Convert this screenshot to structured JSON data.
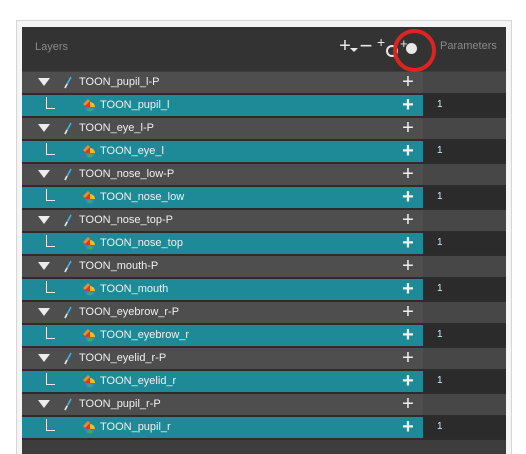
{
  "panel": {
    "title": "Layers",
    "parameters_label": "Parameters",
    "header_buttons": {
      "add_layer": "+",
      "remove_layer": "−",
      "add_peg": "+",
      "add_deformer": "+"
    }
  },
  "colors": {
    "peg_row": "#4e4e4e",
    "drawing_row": "#1f8a97",
    "highlight": "#dd2421"
  },
  "rows": [
    {
      "type": "peg",
      "name": "TOON_pupil_l-P",
      "add": "+",
      "param": ""
    },
    {
      "type": "drawing",
      "name": "TOON_pupil_l",
      "add": "+",
      "param": "1"
    },
    {
      "type": "peg",
      "name": "TOON_eye_l-P",
      "add": "+",
      "param": ""
    },
    {
      "type": "drawing",
      "name": "TOON_eye_l",
      "add": "+",
      "param": "1"
    },
    {
      "type": "peg",
      "name": "TOON_nose_low-P",
      "add": "+",
      "param": ""
    },
    {
      "type": "drawing",
      "name": "TOON_nose_low",
      "add": "+",
      "param": "1"
    },
    {
      "type": "peg",
      "name": "TOON_nose_top-P",
      "add": "+",
      "param": ""
    },
    {
      "type": "drawing",
      "name": "TOON_nose_top",
      "add": "+",
      "param": "1"
    },
    {
      "type": "peg",
      "name": "TOON_mouth-P",
      "add": "+",
      "param": ""
    },
    {
      "type": "drawing",
      "name": "TOON_mouth",
      "add": "+",
      "param": "1"
    },
    {
      "type": "peg",
      "name": "TOON_eyebrow_r-P",
      "add": "+",
      "param": ""
    },
    {
      "type": "drawing",
      "name": "TOON_eyebrow_r",
      "add": "+",
      "param": "1"
    },
    {
      "type": "peg",
      "name": "TOON_eyelid_r-P",
      "add": "+",
      "param": ""
    },
    {
      "type": "drawing",
      "name": "TOON_eyelid_r",
      "add": "+",
      "param": "1"
    },
    {
      "type": "peg",
      "name": "TOON_pupil_r-P",
      "add": "+",
      "param": ""
    },
    {
      "type": "drawing",
      "name": "TOON_pupil_r",
      "add": "+",
      "param": "1"
    }
  ]
}
